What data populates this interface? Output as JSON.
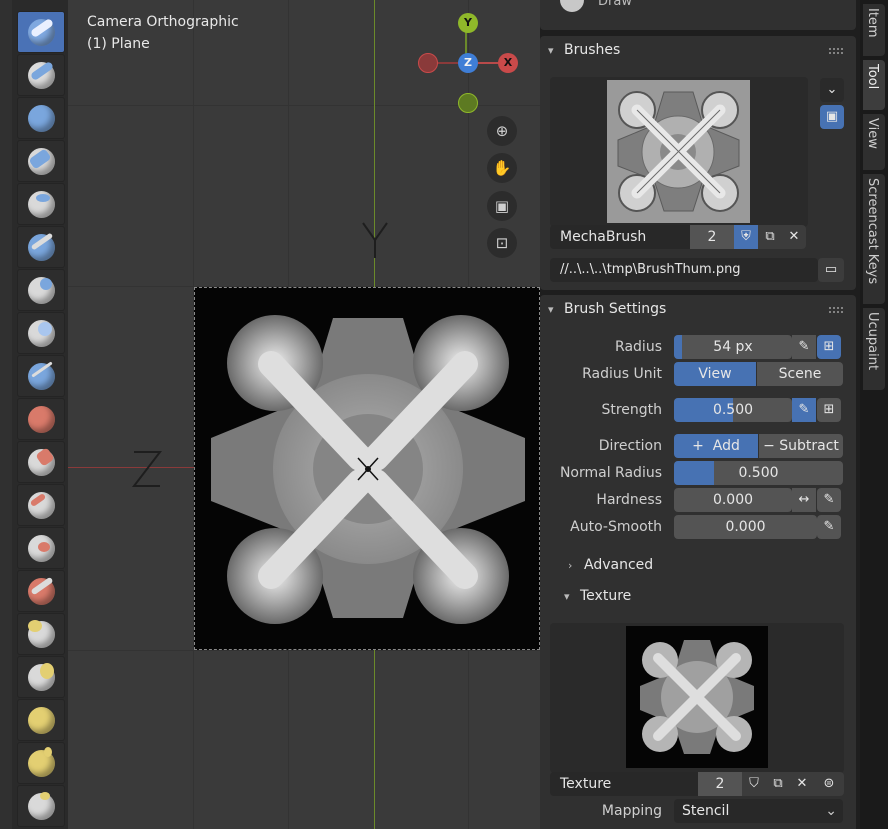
{
  "viewport": {
    "camera_line1": "Camera Orthographic",
    "camera_line2": "(1) Plane",
    "gizmo": {
      "y": "Y",
      "z": "Z",
      "x": "X"
    },
    "axis_label_y": "Y",
    "axis_label_z": "Z"
  },
  "top_partial": {
    "label": "Draw"
  },
  "brushes": {
    "header": "Brushes",
    "name": "MechaBrush",
    "users": "2",
    "path": "//..\\..\\..\\tmp\\BrushThum.png"
  },
  "brush_settings": {
    "header": "Brush Settings",
    "radius_label": "Radius",
    "radius_value": "54 px",
    "radius_unit_label": "Radius Unit",
    "radius_unit_view": "View",
    "radius_unit_scene": "Scene",
    "strength_label": "Strength",
    "strength_value": "0.500",
    "strength_fraction": 0.5,
    "direction_label": "Direction",
    "direction_add": "Add",
    "direction_subtract": "Subtract",
    "normal_radius_label": "Normal Radius",
    "normal_radius_value": "0.500",
    "normal_radius_fraction": 0.5,
    "hardness_label": "Hardness",
    "hardness_value": "0.000",
    "auto_smooth_label": "Auto-Smooth",
    "auto_smooth_value": "0.000",
    "advanced_label": "Advanced",
    "texture_label": "Texture"
  },
  "texture": {
    "name": "Texture",
    "users": "2",
    "mapping_label": "Mapping",
    "mapping_value": "Stencil"
  },
  "side_tabs": [
    "Item",
    "Tool",
    "View",
    "Screencast Keys",
    "Ucupaint"
  ],
  "colors": {
    "accent": "#4772b3",
    "active_tool": "#4a72b6",
    "field": "#545454",
    "panel": "#303030"
  }
}
